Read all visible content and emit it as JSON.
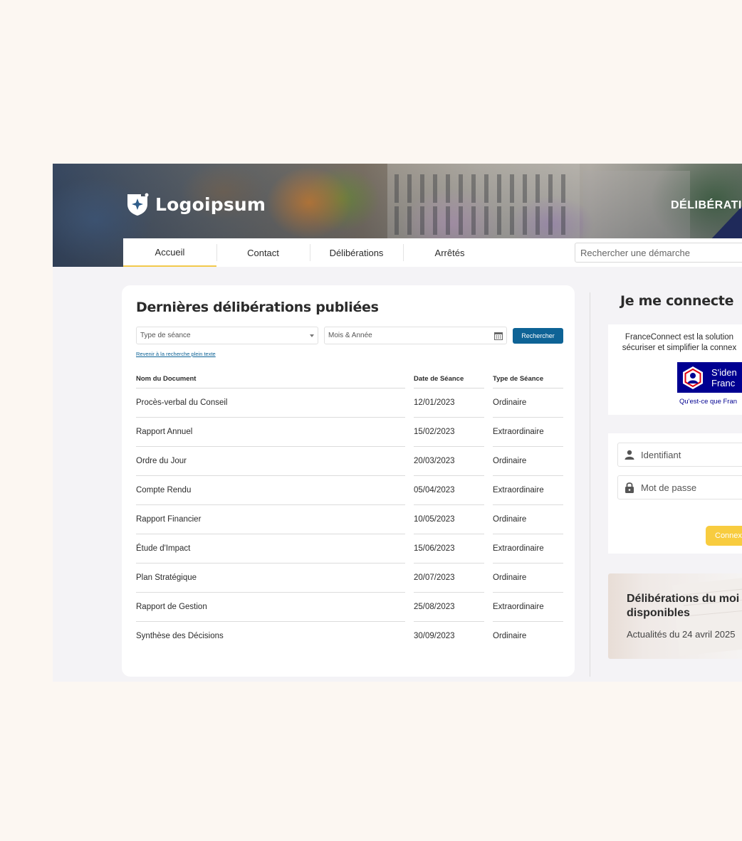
{
  "header": {
    "logo_text": "Logoipsum",
    "banner_title": "DÉLIBÉRATIONS"
  },
  "nav": {
    "tabs": [
      {
        "label": "Accueil",
        "active": true
      },
      {
        "label": "Contact",
        "active": false
      },
      {
        "label": "Délibérations",
        "active": false
      },
      {
        "label": "Arrêtés",
        "active": false
      }
    ],
    "search_placeholder": "Rechercher une démarche"
  },
  "main": {
    "title": "Dernières délibérations publiées",
    "filters": {
      "session_type_placeholder": "Type de séance",
      "month_year_placeholder": "Mois & Année",
      "search_button": "Rechercher",
      "fulltext_link": "Revenir à la recherche plein texte"
    },
    "table": {
      "columns": [
        "Nom du Document",
        "Date de Séance",
        "Type de Séance"
      ],
      "rows": [
        [
          "Procès-verbal du Conseil",
          "12/01/2023",
          "Ordinaire"
        ],
        [
          "Rapport Annuel",
          "15/02/2023",
          "Extraordinaire"
        ],
        [
          "Ordre du Jour",
          "20/03/2023",
          "Ordinaire"
        ],
        [
          "Compte Rendu",
          "05/04/2023",
          "Extraordinaire"
        ],
        [
          "Rapport Financier",
          "10/05/2023",
          "Ordinaire"
        ],
        [
          "Étude d'Impact",
          "15/06/2023",
          "Extraordinaire"
        ],
        [
          "Plan Stratégique",
          "20/07/2023",
          "Ordinaire"
        ],
        [
          "Rapport de Gestion",
          "25/08/2023",
          "Extraordinaire"
        ],
        [
          "Synthèse des Décisions",
          "30/09/2023",
          "Ordinaire"
        ]
      ]
    }
  },
  "sidebar": {
    "connect_title": "Je me connecte",
    "franceconnect": {
      "text_line1": "FranceConnect est la solution",
      "text_line2": "sécuriser et simplifier la connex",
      "button_line1": "S'iden",
      "button_line2": "Franc",
      "link": "Qu'est-ce que Fran"
    },
    "login": {
      "identifier_placeholder": "Identifiant",
      "password_placeholder": "Mot de passe",
      "connect_button": "Connex"
    },
    "news": {
      "title_line1": "Délibérations du moi",
      "title_line2": "disponibles",
      "subtitle": "Actualités du 24 avril 2025"
    }
  },
  "colors": {
    "page_background": "#fcf7f2",
    "primary_blue": "#0e6396",
    "franceconnect_blue": "#000091",
    "accent_yellow": "#f8cc3f",
    "active_tab_underline": "#f2c94c"
  },
  "icons": {
    "logo": "shield-star-icon",
    "select_caret": "caret-down-icon",
    "date_picker": "calendar-icon",
    "identifier": "user-icon",
    "password": "lock-icon",
    "franceconnect": "franceconnect-logo-icon"
  }
}
